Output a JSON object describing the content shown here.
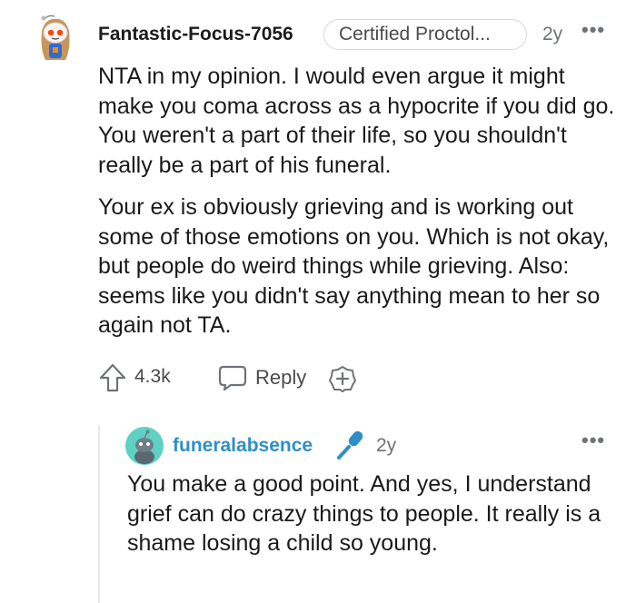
{
  "comment": {
    "username": "Fantastic-Focus-7056",
    "flair": "Certified Proctol...",
    "time": "2y",
    "more_icon": "more-horizontal-icon",
    "avatar_icon": "user-avatar-icon",
    "paragraphs": [
      "NTA in my opinion. I would even argue it might make you coma across as a hypocrite if you did go. You weren't a part of their life, so you shouldn't really be a part of his funeral.",
      "Your ex is obviously grieving and is working out some of those emotions on you. Which is not okay, but people do weird things while grieving. Also: seems like you didn't say anything mean to her so again not TA."
    ],
    "actions": {
      "upvote_icon": "upvote-arrow-icon",
      "score": "4.3k",
      "reply_icon": "speech-bubble-icon",
      "reply_label": "Reply",
      "award_icon": "add-award-icon"
    }
  },
  "reply": {
    "username": "funeralabsence",
    "op_icon": "microphone-icon",
    "time": "2y",
    "more_icon": "more-horizontal-icon",
    "text": "You make a good point. And yes, I understand grief can do crazy things to people. It really is a shame losing a child so young."
  },
  "colors": {
    "text": "#1a1a1b",
    "meta": "#6f7377",
    "op_username": "#2f8fc8",
    "mic": "#2f8fc8",
    "flair_border": "#d4d7da",
    "thread_line": "#e6e7e8"
  }
}
